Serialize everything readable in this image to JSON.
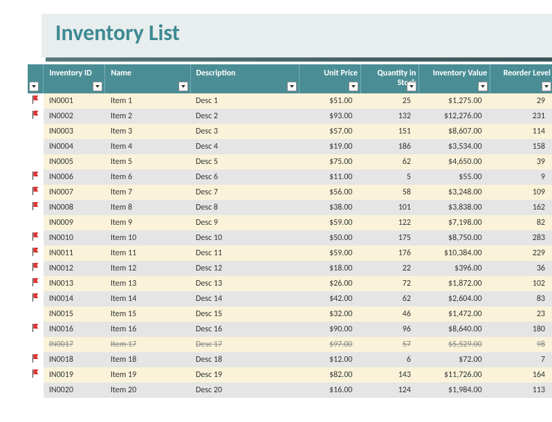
{
  "title": "Inventory List",
  "columns": {
    "flag": "",
    "id": "Inventory ID",
    "name": "Name",
    "desc": "Description",
    "price": "Unit Price",
    "qty": "Quantity in Stock",
    "value": "Inventory Value",
    "reorder": "Reorder Level"
  },
  "rows": [
    {
      "flag": true,
      "id": "IN0001",
      "name": "Item 1",
      "desc": "Desc 1",
      "price": "$51.00",
      "qty": "25",
      "value": "$1,275.00",
      "reorder": "29",
      "strike": false
    },
    {
      "flag": true,
      "id": "IN0002",
      "name": "Item 2",
      "desc": "Desc 2",
      "price": "$93.00",
      "qty": "132",
      "value": "$12,276.00",
      "reorder": "231",
      "strike": false
    },
    {
      "flag": false,
      "id": "IN0003",
      "name": "Item 3",
      "desc": "Desc 3",
      "price": "$57.00",
      "qty": "151",
      "value": "$8,607.00",
      "reorder": "114",
      "strike": false
    },
    {
      "flag": false,
      "id": "IN0004",
      "name": "Item 4",
      "desc": "Desc 4",
      "price": "$19.00",
      "qty": "186",
      "value": "$3,534.00",
      "reorder": "158",
      "strike": false
    },
    {
      "flag": false,
      "id": "IN0005",
      "name": "Item 5",
      "desc": "Desc 5",
      "price": "$75.00",
      "qty": "62",
      "value": "$4,650.00",
      "reorder": "39",
      "strike": false
    },
    {
      "flag": true,
      "id": "IN0006",
      "name": "Item 6",
      "desc": "Desc 6",
      "price": "$11.00",
      "qty": "5",
      "value": "$55.00",
      "reorder": "9",
      "strike": false
    },
    {
      "flag": true,
      "id": "IN0007",
      "name": "Item 7",
      "desc": "Desc 7",
      "price": "$56.00",
      "qty": "58",
      "value": "$3,248.00",
      "reorder": "109",
      "strike": false
    },
    {
      "flag": true,
      "id": "IN0008",
      "name": "Item 8",
      "desc": "Desc 8",
      "price": "$38.00",
      "qty": "101",
      "value": "$3,838.00",
      "reorder": "162",
      "strike": false
    },
    {
      "flag": false,
      "id": "IN0009",
      "name": "Item 9",
      "desc": "Desc 9",
      "price": "$59.00",
      "qty": "122",
      "value": "$7,198.00",
      "reorder": "82",
      "strike": false
    },
    {
      "flag": true,
      "id": "IN0010",
      "name": "Item 10",
      "desc": "Desc 10",
      "price": "$50.00",
      "qty": "175",
      "value": "$8,750.00",
      "reorder": "283",
      "strike": false
    },
    {
      "flag": true,
      "id": "IN0011",
      "name": "Item 11",
      "desc": "Desc 11",
      "price": "$59.00",
      "qty": "176",
      "value": "$10,384.00",
      "reorder": "229",
      "strike": false
    },
    {
      "flag": true,
      "id": "IN0012",
      "name": "Item 12",
      "desc": "Desc 12",
      "price": "$18.00",
      "qty": "22",
      "value": "$396.00",
      "reorder": "36",
      "strike": false
    },
    {
      "flag": true,
      "id": "IN0013",
      "name": "Item 13",
      "desc": "Desc 13",
      "price": "$26.00",
      "qty": "72",
      "value": "$1,872.00",
      "reorder": "102",
      "strike": false
    },
    {
      "flag": true,
      "id": "IN0014",
      "name": "Item 14",
      "desc": "Desc 14",
      "price": "$42.00",
      "qty": "62",
      "value": "$2,604.00",
      "reorder": "83",
      "strike": false
    },
    {
      "flag": false,
      "id": "IN0015",
      "name": "Item 15",
      "desc": "Desc 15",
      "price": "$32.00",
      "qty": "46",
      "value": "$1,472.00",
      "reorder": "23",
      "strike": false
    },
    {
      "flag": true,
      "id": "IN0016",
      "name": "Item 16",
      "desc": "Desc 16",
      "price": "$90.00",
      "qty": "96",
      "value": "$8,640.00",
      "reorder": "180",
      "strike": false
    },
    {
      "flag": false,
      "id": "IN0017",
      "name": "Item 17",
      "desc": "Desc 17",
      "price": "$97.00",
      "qty": "57",
      "value": "$5,529.00",
      "reorder": "98",
      "strike": true
    },
    {
      "flag": true,
      "id": "IN0018",
      "name": "Item 18",
      "desc": "Desc 18",
      "price": "$12.00",
      "qty": "6",
      "value": "$72.00",
      "reorder": "7",
      "strike": false
    },
    {
      "flag": true,
      "id": "IN0019",
      "name": "Item 19",
      "desc": "Desc 19",
      "price": "$82.00",
      "qty": "143",
      "value": "$11,726.00",
      "reorder": "164",
      "strike": false
    },
    {
      "flag": false,
      "id": "IN0020",
      "name": "Item 20",
      "desc": "Desc 20",
      "price": "$16.00",
      "qty": "124",
      "value": "$1,984.00",
      "reorder": "113",
      "strike": false
    }
  ]
}
